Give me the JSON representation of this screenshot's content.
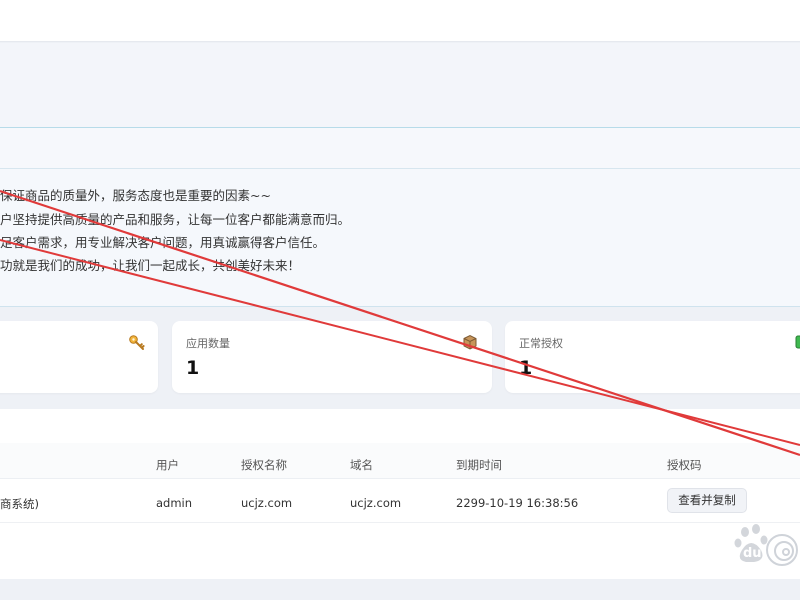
{
  "notice": {
    "lines": [
      "保证商品的质量外，服务态度也是重要的因素~~",
      "户坚持提供高质量的产品和服务，让每一位客户都能满意而归。",
      "足客户需求，用专业解决客户问题，用真诚赢得客户信任。",
      "功就是我们的成功，让我们一起成长，共创美好未来！"
    ]
  },
  "cards": [
    {
      "title": "",
      "value": "",
      "icon": "key-icon"
    },
    {
      "title": "应用数量",
      "value": "1",
      "icon": "box-icon"
    },
    {
      "title": "正常授权",
      "value": "1",
      "icon": "check-icon"
    }
  ],
  "table": {
    "headers": [
      "用户",
      "授权名称",
      "域名",
      "到期时间",
      "授权码"
    ],
    "rows": [
      {
        "app": "商系统)",
        "user": "admin",
        "auth_name": "ucjz.com",
        "domain": "ucjz.com",
        "expire": "2299-10-19 16:38:56",
        "action": "查看并复制"
      }
    ]
  },
  "watermark": {
    "text": "du"
  },
  "colors": {
    "background": "#eef1f6",
    "card": "#ffffff",
    "annotation": "#e03a3a",
    "border_accent": "#b7dbe9"
  }
}
